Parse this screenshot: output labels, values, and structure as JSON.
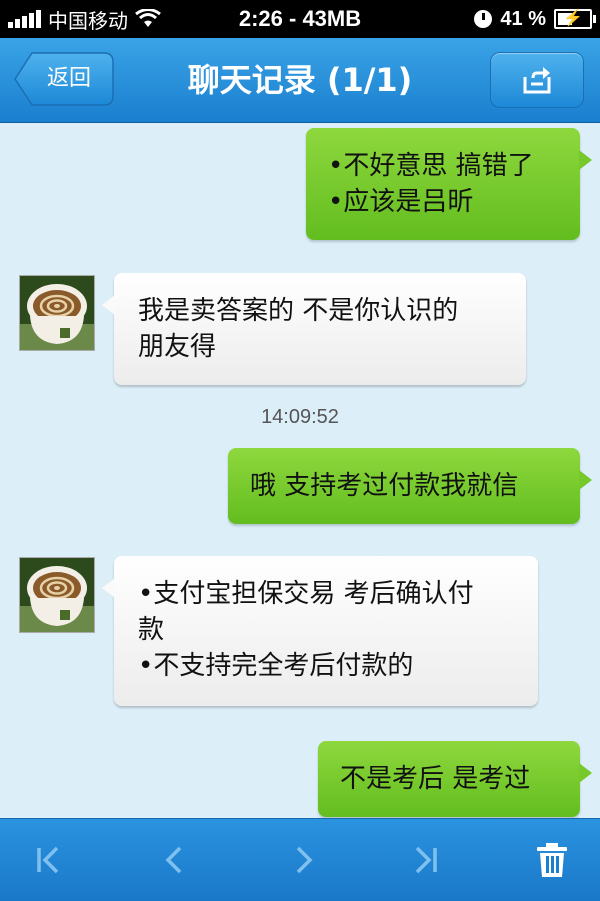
{
  "status_bar": {
    "carrier": "中国移动",
    "center": "2:26 - 43MB",
    "battery": "41 %",
    "battery_level": 0.41
  },
  "navbar": {
    "back_label": "返回",
    "title": "聊天记录 (1/1)",
    "share_icon": "share-icon"
  },
  "messages": [
    {
      "side": "me",
      "lines": [
        "•不好意思 搞错了",
        "•应该是吕昕"
      ]
    },
    {
      "side": "other",
      "avatar": "coffee-cup-avatar",
      "lines": [
        "我是卖答案的 不是你认识的",
        "朋友得"
      ]
    },
    {
      "timestamp": "14:09:52"
    },
    {
      "side": "me",
      "lines": [
        "哦 支持考过付款我就信"
      ]
    },
    {
      "side": "other",
      "avatar": "coffee-cup-avatar",
      "lines": [
        "•支付宝担保交易 考后确认付",
        "款",
        "•不支持完全考后付款的"
      ]
    },
    {
      "side": "me",
      "lines": [
        "不是考后 是考过"
      ]
    }
  ],
  "toolbar": {
    "buttons": [
      "first-page-icon",
      "previous-icon",
      "next-icon",
      "last-page-icon",
      "trash-icon"
    ]
  },
  "colors": {
    "nav_blue": "#1a7fcf",
    "chat_bg": "#dceef8",
    "bubble_green": "#63bd1e"
  }
}
